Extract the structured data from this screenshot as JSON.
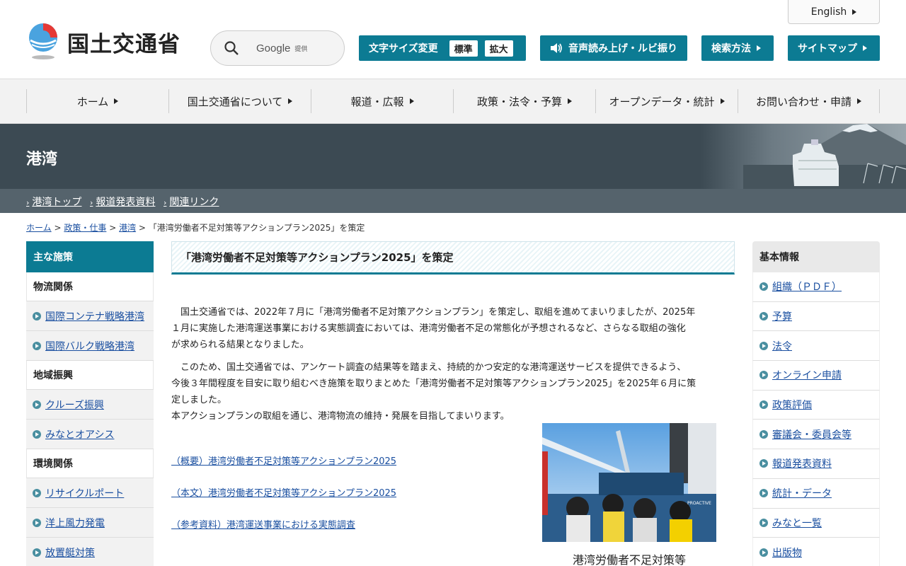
{
  "header": {
    "site_name": "国土交通省",
    "search": {
      "provider": "Google",
      "provider_suffix": "提供"
    },
    "font_size": {
      "label": "文字サイズ変更",
      "standard": "標準",
      "large": "拡大"
    },
    "voice_label": "音声読み上げ・ルビ振り",
    "howto_label": "検索方法",
    "sitemap_label": "サイトマップ",
    "english_label": "English"
  },
  "nav": [
    "ホーム",
    "国土交通省について",
    "報道・広報",
    "政策・法令・予算",
    "オープンデータ・統計",
    "お問い合わせ・申請"
  ],
  "banner": {
    "title": "港湾",
    "subnav": [
      "港湾トップ",
      "報道発表資料",
      "関連リンク"
    ]
  },
  "breadcrumb": {
    "items": [
      "ホーム",
      "政策・仕事",
      "港湾"
    ],
    "current": "「港湾労働者不足対策等アクションプラン2025」を策定"
  },
  "left_sidebar": {
    "title": "主な施策",
    "sections": [
      {
        "label": "物流関係",
        "items": [
          "国際コンテナ戦略港湾",
          "国際バルク戦略港湾"
        ]
      },
      {
        "label": "地域振興",
        "items": [
          "クルーズ振興",
          "みなとオアシス"
        ]
      },
      {
        "label": "環境関係",
        "items": [
          "リサイクルポート",
          "洋上風力発電",
          "放置艇対策"
        ]
      }
    ]
  },
  "main": {
    "title": "「港湾労働者不足対策等アクションプラン2025」を策定",
    "p1_line1": "　国土交通省では、2022年７月に「港湾労働者不足対策アクションプラン」を策定し、取組を進めてまいりましたが、2025年",
    "p1_line2": "１月に実施した港湾運送事業における実態調査においては、港湾労働者不足の常態化が予想されるなど、さらなる取組の強化",
    "p1_line3": "が求められる結果となりました。",
    "p2_line1": "　このため、国土交通省では、アンケート調査の結果等を踏まえ、持続的かつ安定的な港湾運送サービスを提供できるよう、",
    "p2_line2": "今後３年間程度を目安に取り組むべき施策を取りまとめた「港湾労働者不足対策等アクションプラン2025」を2025年６月に策",
    "p2_line3": "定しました。",
    "p3": " 本アクションプランの取組を通じ、港湾物流の維持・発展を目指してまいります。",
    "links": [
      "（概要）港湾労働者不足対策等アクションプラン2025",
      "（本文）港湾労働者不足対策等アクションプラン2025",
      "（参考資料）港湾運送事業における実態調査"
    ],
    "photo_caption": "港湾労働者不足対策等"
  },
  "right_sidebar": {
    "title": "基本情報",
    "items": [
      "組織（ＰＤＦ）",
      "予算",
      "法令",
      "オンライン申請",
      "政策評価",
      "審議会・委員会等",
      "報道発表資料",
      "統計・データ",
      "みなと一覧",
      "出版物"
    ]
  },
  "colors": {
    "accent": "#0c7b93",
    "banner": "#3c4a53",
    "link": "#1a4fa0"
  }
}
